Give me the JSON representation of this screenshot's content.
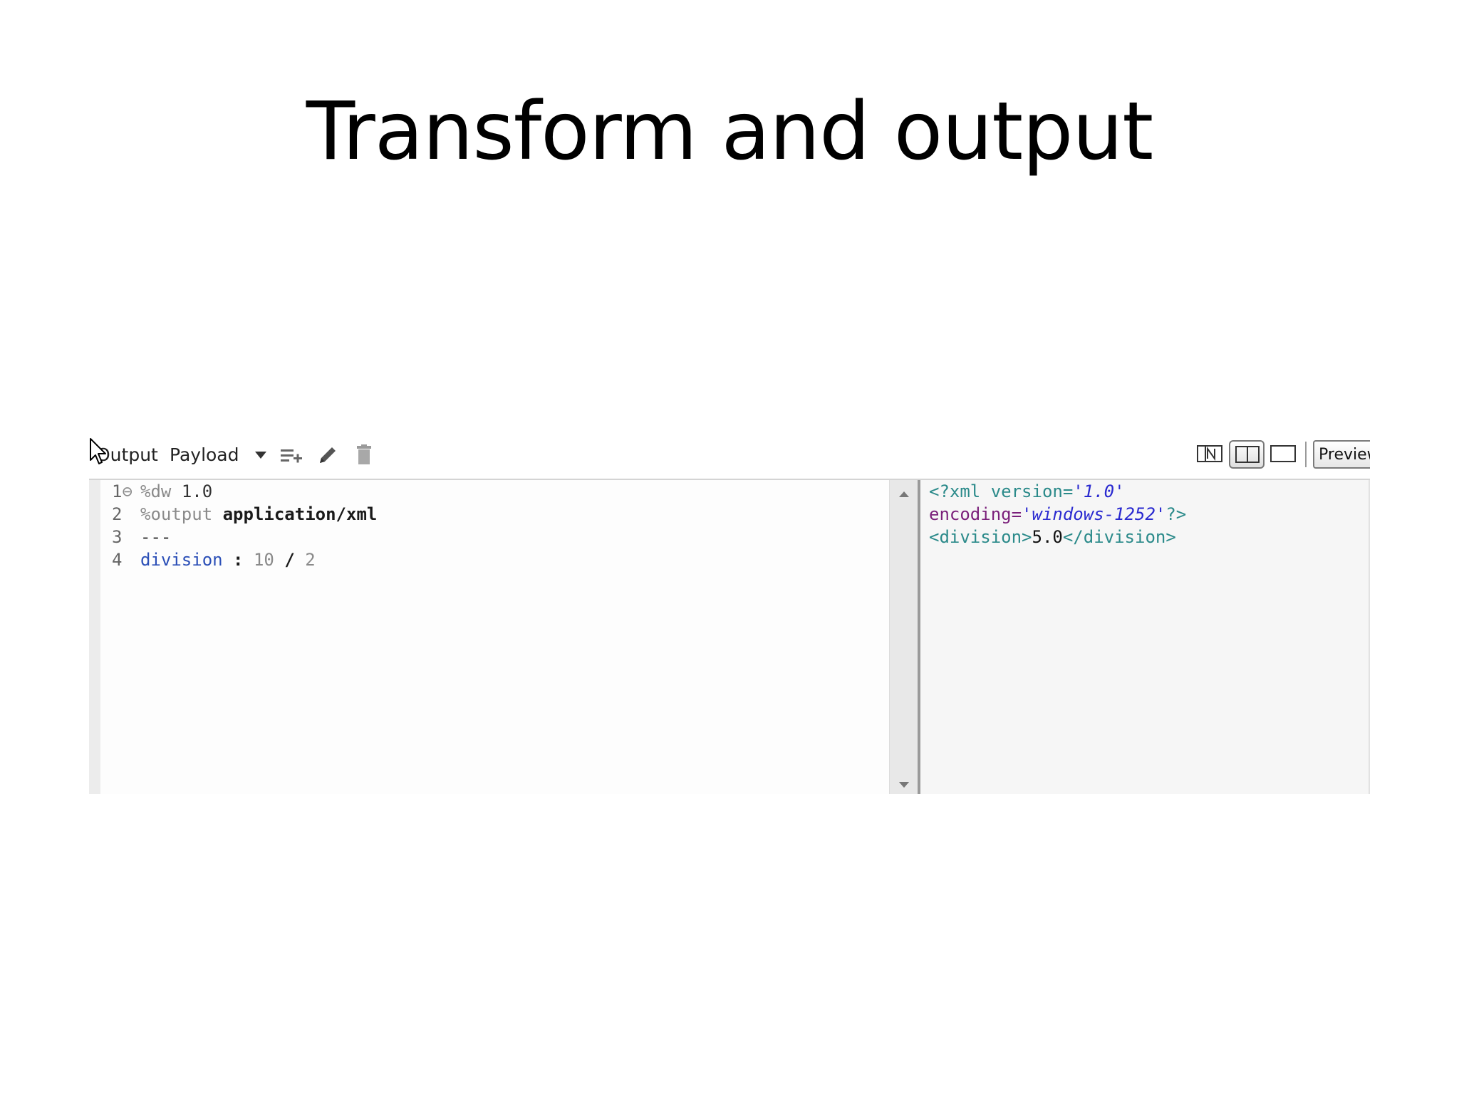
{
  "slide": {
    "title": "Transform and output"
  },
  "toolbar": {
    "output_label": "Output",
    "payload_label": "Payload",
    "preview_label": "Preview",
    "icons": [
      "dropdown-caret-icon",
      "add-list-icon",
      "pencil-icon",
      "trash-icon",
      "n-view-icon",
      "split-view-icon",
      "single-view-icon"
    ]
  },
  "code": {
    "lines": [
      {
        "num": "1",
        "fold": "⊖",
        "directive": "%dw",
        "value": "1.0"
      },
      {
        "num": "2",
        "directive": "%output",
        "value": "application/xml"
      },
      {
        "num": "3",
        "text": "---"
      },
      {
        "num": "4",
        "key": "division",
        "colon": ":",
        "expr_a": "10",
        "op": "/",
        "expr_b": "2"
      }
    ]
  },
  "output": {
    "line1_open": "<?xml version=",
    "version_val": "'1.0'",
    "line2_key": "encoding=",
    "encoding_val": "'windows-1252'",
    "line2_close": "?>",
    "tag_open": "<division>",
    "tag_value": "5.0",
    "tag_close": "</division>"
  }
}
